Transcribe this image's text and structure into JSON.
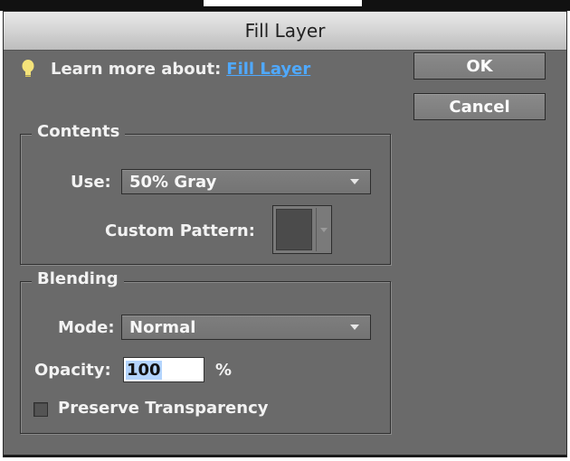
{
  "window": {
    "title": "Fill Layer"
  },
  "learn_more": {
    "prefix": "Learn more about:",
    "link": "Fill Layer"
  },
  "buttons": {
    "ok": "OK",
    "cancel": "Cancel"
  },
  "contents": {
    "legend": "Contents",
    "use_label": "Use:",
    "use_value": "50% Gray",
    "custom_pattern_label": "Custom Pattern:"
  },
  "blending": {
    "legend": "Blending",
    "mode_label": "Mode:",
    "mode_value": "Normal",
    "opacity_label": "Opacity:",
    "opacity_value": "100",
    "opacity_unit": "%",
    "preserve_transparency_label": "Preserve Transparency",
    "preserve_transparency_checked": false
  },
  "colors": {
    "dialog_bg": "#6a6a6a",
    "link": "#4fa9ff",
    "bulb": "#f4e37a"
  },
  "icons": {
    "learn_more": "lightbulb-icon",
    "dropdown": "chevron-down-icon"
  }
}
